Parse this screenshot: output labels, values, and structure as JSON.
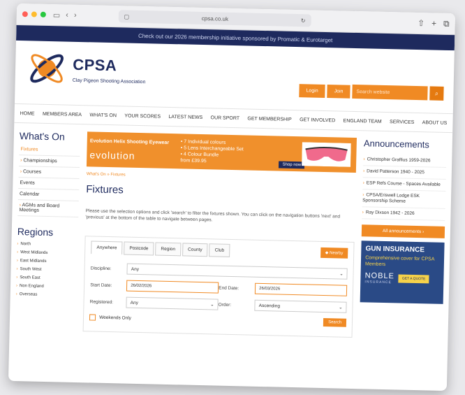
{
  "browser": {
    "url": "cpsa.co.uk",
    "icons": [
      "sidebar-icon",
      "back-icon",
      "forward-icon",
      "reload-icon",
      "share-icon",
      "new-tab-icon",
      "tabs-icon"
    ]
  },
  "banner": {
    "text": "Check out our 2026 membership initiative sponsored by Promatic & Eurotarget"
  },
  "header": {
    "title": "CPSA",
    "subtitle": "Clay Pigeon Shooting Association",
    "login": "Login",
    "join": "Join",
    "search_placeholder": "Search website"
  },
  "nav": {
    "items": [
      "HOME",
      "MEMBERS AREA",
      "WHAT'S ON",
      "YOUR SCORES",
      "LATEST NEWS",
      "OUR SPORT",
      "GET MEMBERSHIP",
      "GET INVOLVED",
      "ENGLAND TEAM",
      "SERVICES",
      "ABOUT US"
    ]
  },
  "left": {
    "whats_on_title": "What's On",
    "items": [
      "Fixtures",
      "Championships",
      "Courses",
      "Events",
      "Calendar",
      "AGMs and Board Meetings"
    ],
    "regions_title": "Regions",
    "regions": [
      "North",
      "West Midlands",
      "East Midlands",
      "South West",
      "South East",
      "Non England",
      "Overseas"
    ]
  },
  "ad": {
    "title": "Evolution Helix Shooting Eyewear",
    "brand": "evolution",
    "points": [
      "7 Individual colours",
      "5 Lens Interchangeable Set",
      "4 Colour Bundle",
      "from £39.95"
    ],
    "shop": "Shop now"
  },
  "main": {
    "breadcrumb": [
      "What's On",
      "Fixtures"
    ],
    "title": "Fixtures",
    "intro": "Please use the selection options and click 'search' to filter the fixtures shown. You can click on the navigation buttons 'next' and 'previous' at the bottom of the table to navigate between pages."
  },
  "filter": {
    "tabs": [
      "Anywhere",
      "Postcode",
      "Region",
      "County",
      "Club"
    ],
    "nearby": "Nearby",
    "discipline_label": "Discipline:",
    "discipline_value": "Any",
    "start_label": "Start Date:",
    "start_value": "26/02/2026",
    "end_label": "End Date:",
    "end_value": "26/03/2026",
    "registered_label": "Registered:",
    "registered_value": "Any",
    "order_label": "Order:",
    "order_value": "Ascending",
    "weekends_label": "Weekends Only",
    "search_button": "Search"
  },
  "right": {
    "title": "Announcements",
    "items": [
      "Christopher Graffius 1959-2026",
      "David Patterson 1940 - 2025",
      "ESP Refs Course - Spaces Available",
      "CPSA/Eriswell Lodge ESK Sponsorship Scheme",
      "Ray Dixson 1942 - 2026"
    ],
    "all_button": "All announcements",
    "gun_title": "GUN INSURANCE",
    "gun_sub": "Comprehensive cover for CPSA Members",
    "noble": "NOBLE",
    "noble_sub": "INSURANCE",
    "quote": "GET A QUOTE"
  },
  "colors": {
    "navy": "#1e2a5e",
    "orange": "#f08a24"
  }
}
